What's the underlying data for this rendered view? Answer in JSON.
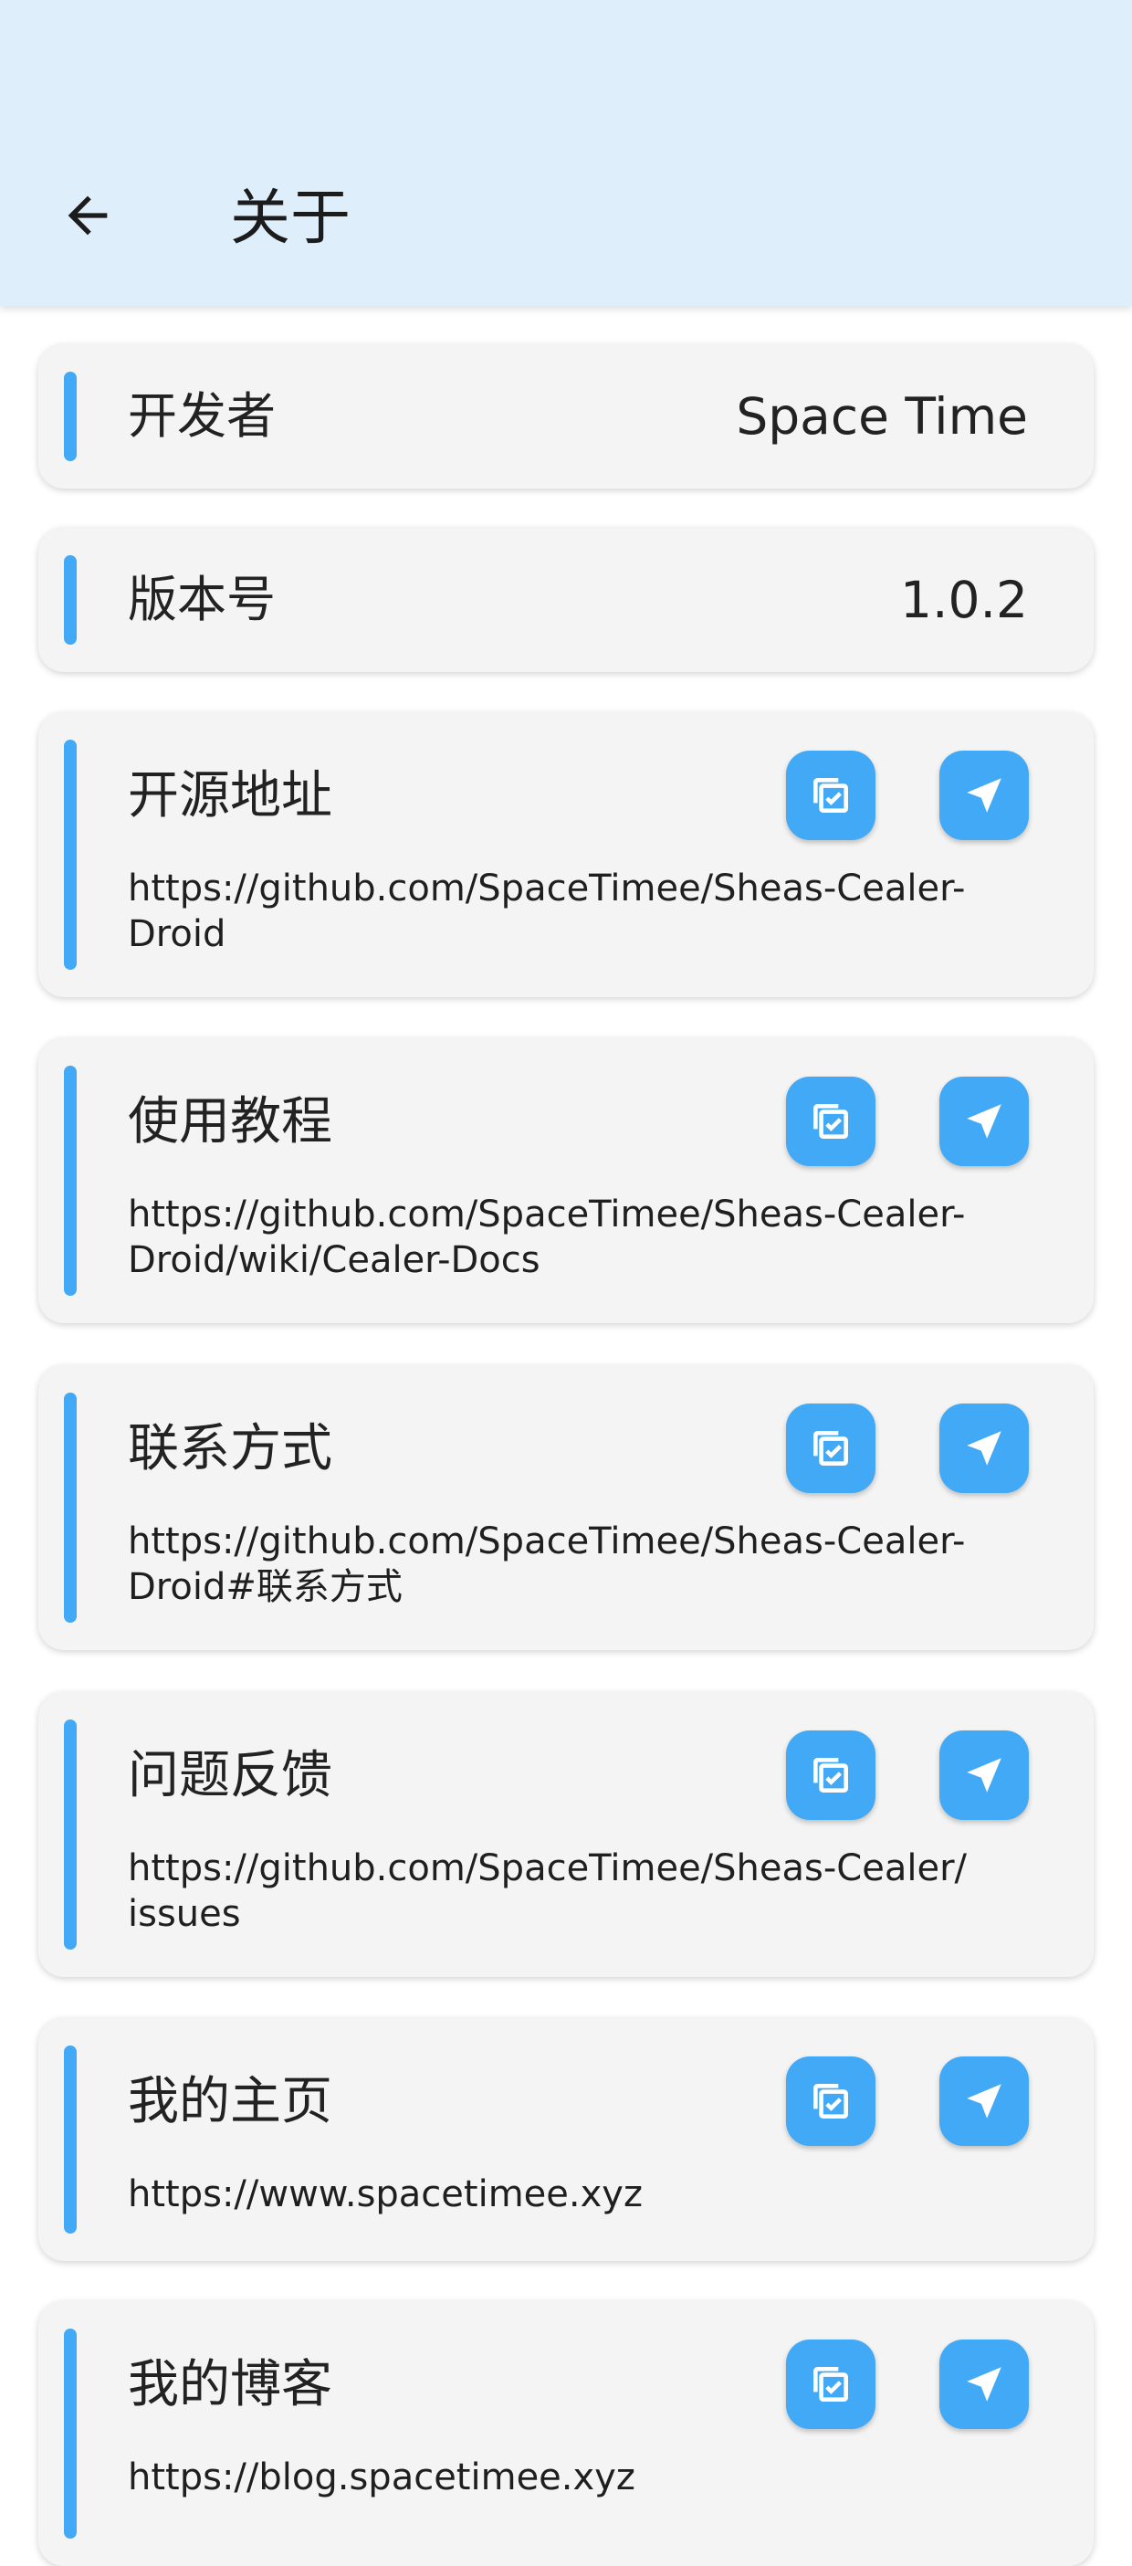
{
  "appbar": {
    "title": "关于",
    "back_icon": "arrow-left-icon"
  },
  "colors": {
    "appbar_bg": "#deeefb",
    "accent": "#42a9f7",
    "card_bg": "#f4f4f4"
  },
  "info_rows": [
    {
      "label": "开发者",
      "value": "Space Time"
    },
    {
      "label": "版本号",
      "value": "1.0.2"
    }
  ],
  "links": [
    {
      "title": "开源地址",
      "url": "https://github.com/SpaceTimee/Sheas-Cealer-Droid"
    },
    {
      "title": "使用教程",
      "url": "https://github.com/SpaceTimee/Sheas-Cealer-Droid/wiki/Cealer-Docs"
    },
    {
      "title": "联系方式",
      "url": "https://github.com/SpaceTimee/Sheas-Cealer-Droid#联系方式"
    },
    {
      "title": "问题反馈",
      "url": "https://github.com/SpaceTimee/Sheas-Cealer/issues"
    },
    {
      "title": "我的主页",
      "url": "https://www.spacetimee.xyz"
    },
    {
      "title": "我的博客",
      "url": "https://blog.spacetimee.xyz"
    }
  ],
  "icons": {
    "copy": "copy-icon",
    "open": "open-link-icon"
  }
}
